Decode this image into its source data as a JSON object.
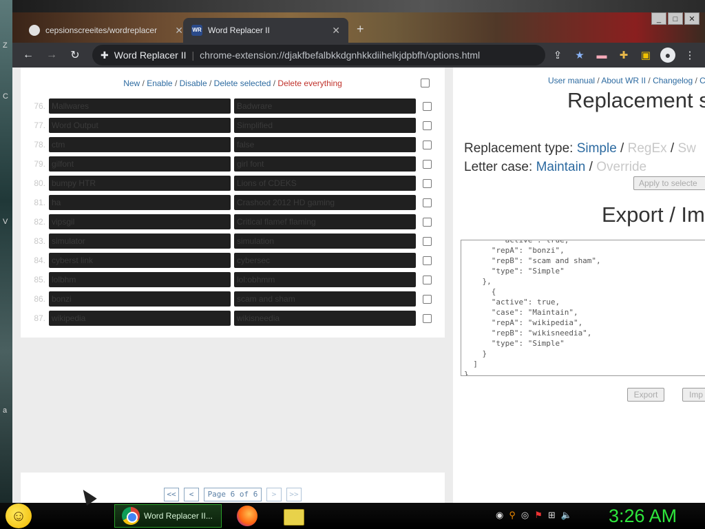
{
  "desktop": {
    "side_letters": [
      "Z",
      "C",
      "V",
      "a"
    ]
  },
  "window": {
    "controls": [
      "_",
      "□",
      "✕"
    ]
  },
  "tabs": [
    {
      "title": "cepsionscreeites/wordreplacer",
      "active": false,
      "close": "✕"
    },
    {
      "title": "Word Replacer II",
      "active": true,
      "close": "✕",
      "favicon": "WR"
    }
  ],
  "new_tab": "+",
  "toolbar": {
    "back": "←",
    "forward": "→",
    "reload": "↻",
    "site_name": "Word Replacer II",
    "separator": "|",
    "url": "chrome-extension://djakfbefalbkkdgnhkkdiihelkjdpbfh/options.html",
    "icons": [
      "share-icon",
      "star-icon",
      "flag-icon",
      "puzzle-icon",
      "sidepanel-icon",
      "account-icon"
    ]
  },
  "list": {
    "actions": {
      "new": "New",
      "enable": "Enable",
      "disable": "Disable",
      "delete_selected": "Delete selected",
      "delete_everything": "Delete everything",
      "sep": " / "
    },
    "rows": [
      {
        "num": "76.",
        "a": "Mallwares",
        "b": "Badwrare"
      },
      {
        "num": "77.",
        "a": "Word Output",
        "b": "Simplified"
      },
      {
        "num": "78.",
        "a": "ctm",
        "b": "false"
      },
      {
        "num": "79.",
        "a": "gilfont",
        "b": "girl font"
      },
      {
        "num": "80.",
        "a": "bumpy HTR",
        "b": "Lions of CDEKS"
      },
      {
        "num": "81.",
        "a": "ha",
        "b": "Crashoot 2012 HD gaming"
      },
      {
        "num": "82.",
        "a": "vipsgil",
        "b": "Critical flamef flaming"
      },
      {
        "num": "83.",
        "a": "simulator",
        "b": "simulation"
      },
      {
        "num": "84.",
        "a": "cyberst link",
        "b": "cybersec"
      },
      {
        "num": "85.",
        "a": "lolbhm",
        "b": "lol:obhmm"
      },
      {
        "num": "86.",
        "a": "bonzi",
        "b": "scam and sham"
      },
      {
        "num": "87.",
        "a": "wikipedia",
        "b": "wikisneedia"
      }
    ]
  },
  "pager": {
    "first": "<<",
    "prev": "<",
    "info": "Page 6 of 6",
    "next": ">",
    "last": ">>"
  },
  "right": {
    "links": {
      "manual": "User manual",
      "about": "About WR II",
      "changelog": "Changelog",
      "sep": " / ",
      "tail": "C"
    },
    "heading_replacement": "Replacement s",
    "replacement_type": {
      "label": "Replacement type: ",
      "simple": "Simple",
      "regex": "RegEx",
      "swap": "Sw",
      "sep": " / "
    },
    "letter_case": {
      "label": "Letter case: ",
      "maintain": "Maintain",
      "override": "Override",
      "sep": " / "
    },
    "apply_button": "Apply to selecte",
    "heading_export": "Export / Im",
    "json_text": "        \"active\": true,\n      \"repA\": \"bonzi\",\n      \"repB\": \"scam and sham\",\n      \"type\": \"Simple\"\n    },\n      {\n      \"active\": true,\n      \"case\": \"Maintain\",\n      \"repA\": \"wikipedia\",\n      \"repB\": \"wikisneedia\",\n      \"type\": \"Simple\"\n    }\n  ]\n}",
    "export_button": "Export",
    "import_button": "Imp"
  },
  "taskbar": {
    "smiley": "☺",
    "chrome_task": "Word Replacer II...",
    "tray_icons": [
      "cd-icon",
      "search-icon",
      "disk-icon",
      "flag-icon",
      "network-icon",
      "volume-icon"
    ],
    "tray_glyphs": [
      "◉",
      "⚲",
      "◎",
      "⚑",
      "⊞",
      "🔈"
    ],
    "clock": "3:26 AM"
  }
}
